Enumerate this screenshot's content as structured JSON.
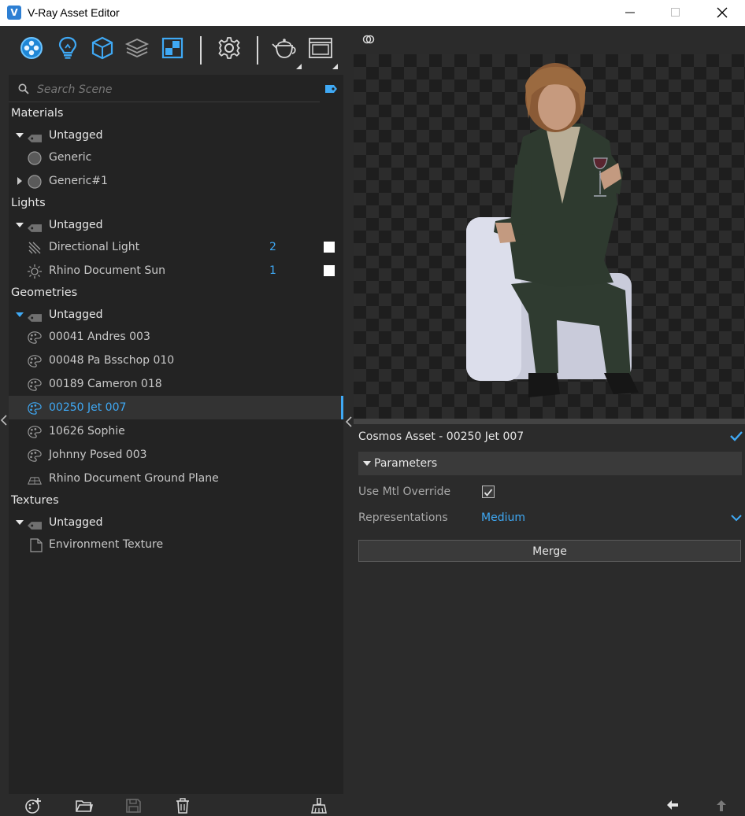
{
  "window": {
    "title": "V-Ray Asset Editor",
    "logo_letter": "V"
  },
  "toolbar": {
    "icons": [
      "materials-icon",
      "lights-icon",
      "geometry-icon",
      "render-elements-icon",
      "textures-icon",
      "settings-icon",
      "render-teapot-icon",
      "frame-buffer-icon"
    ]
  },
  "search": {
    "placeholder": "Search Scene"
  },
  "tree": {
    "materials": {
      "label": "Materials",
      "group": "Untagged",
      "items": [
        {
          "label": "Generic"
        },
        {
          "label": "Generic#1"
        }
      ]
    },
    "lights": {
      "label": "Lights",
      "group": "Untagged",
      "items": [
        {
          "label": "Directional Light",
          "count": "2"
        },
        {
          "label": "Rhino Document Sun",
          "count": "1"
        }
      ]
    },
    "geometries": {
      "label": "Geometries",
      "group": "Untagged",
      "items": [
        {
          "label": "00041 Andres 003"
        },
        {
          "label": "00048 Pa Bsschop 010"
        },
        {
          "label": "00189 Cameron 018"
        },
        {
          "label": "00250 Jet 007"
        },
        {
          "label": "10626 Sophie"
        },
        {
          "label": "Johnny Posed 003"
        },
        {
          "label": "Rhino Document Ground Plane"
        }
      ]
    },
    "textures": {
      "label": "Textures",
      "group": "Untagged",
      "items": [
        {
          "label": "Environment Texture"
        }
      ]
    }
  },
  "properties": {
    "title": "Cosmos Asset - 00250 Jet 007",
    "section": "Parameters",
    "use_mtl_override_label": "Use Mtl Override",
    "use_mtl_override_checked": true,
    "representations_label": "Representations",
    "representations_value": "Medium",
    "merge_label": "Merge"
  },
  "colors": {
    "accent": "#3fa9f5",
    "panel": "#232323",
    "background": "#2b2b2b"
  }
}
